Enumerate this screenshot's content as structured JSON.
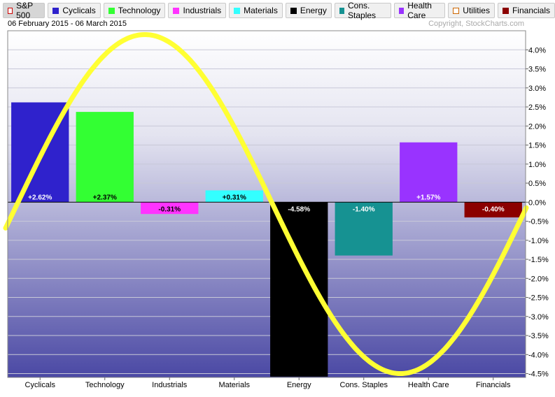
{
  "legend": {
    "items": [
      {
        "label": "S&P 500",
        "color": "#ffffff",
        "border": "#cc0000",
        "active": true
      },
      {
        "label": "Cyclicals",
        "color": "#2f22cc",
        "border": "#2f22cc"
      },
      {
        "label": "Technology",
        "color": "#33ff33",
        "border": "#33ff33"
      },
      {
        "label": "Industrials",
        "color": "#ff33ff",
        "border": "#ff33ff"
      },
      {
        "label": "Materials",
        "color": "#33ffff",
        "border": "#33ffff"
      },
      {
        "label": "Energy",
        "color": "#000000",
        "border": "#000000"
      },
      {
        "label": "Cons. Staples",
        "color": "#169292",
        "border": "#169292"
      },
      {
        "label": "Health Care",
        "color": "#9933ff",
        "border": "#9933ff"
      },
      {
        "label": "Utilities",
        "color": "#ffffff",
        "border": "#cc6600"
      },
      {
        "label": "Financials",
        "color": "#8b0000",
        "border": "#8b0000"
      }
    ]
  },
  "header": {
    "date_range": "06 February 2015 - 06 March 2015",
    "copyright": "Copyright, StockCharts.com"
  },
  "chart_data": {
    "type": "bar",
    "categories": [
      "Cyclicals",
      "Technology",
      "Industrials",
      "Materials",
      "Energy",
      "Cons. Staples",
      "Health Care",
      "Financials"
    ],
    "values": [
      2.62,
      2.37,
      -0.31,
      0.31,
      -4.58,
      -1.4,
      1.57,
      -0.4
    ],
    "data_labels": [
      "+2.62%",
      "+2.37%",
      "-0.31%",
      "+0.31%",
      "-4.58%",
      "-1.40%",
      "+1.57%",
      "-0.40%"
    ],
    "colors": [
      "#2f22cc",
      "#33ff33",
      "#ff33ff",
      "#33ffff",
      "#000000",
      "#169292",
      "#9933ff",
      "#8b0000"
    ],
    "label_colors": [
      "#ffffff",
      "#000000",
      "#000000",
      "#000000",
      "#ffffff",
      "#ffffff",
      "#ffffff",
      "#ffffff"
    ],
    "y_ticks": [
      "4.0%",
      "3.5%",
      "3.0%",
      "2.5%",
      "2.0%",
      "1.5%",
      "1.0%",
      "0.5%",
      "0.0%",
      "-0.5%",
      "-1.0%",
      "-1.5%",
      "-2.0%",
      "-2.5%",
      "-3.0%",
      "-3.5%",
      "-4.0%",
      "-4.5%"
    ],
    "y_tick_values": [
      4.0,
      3.5,
      3.0,
      2.5,
      2.0,
      1.5,
      1.0,
      0.5,
      0.0,
      -0.5,
      -1.0,
      -1.5,
      -2.0,
      -2.5,
      -3.0,
      -3.5,
      -4.0,
      -4.5
    ],
    "ylim": [
      -4.6,
      4.5
    ],
    "grid": true,
    "overlay_curve": {
      "color": "#ffff33",
      "shape": "sine wave",
      "peak": 4.4,
      "trough": -4.5
    }
  }
}
